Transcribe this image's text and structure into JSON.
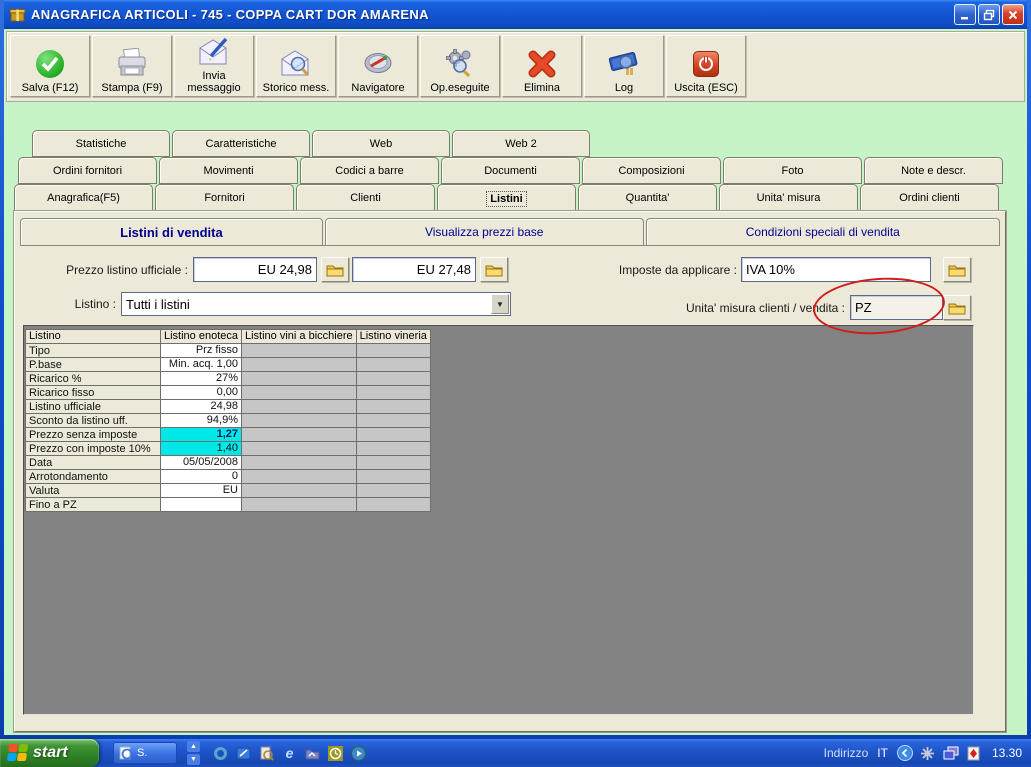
{
  "window": {
    "title": "ANAGRAFICA ARTICOLI - 745 - COPPA CART DOR AMARENA",
    "controls": [
      "minimize",
      "restore",
      "close"
    ]
  },
  "colors": {
    "desktop_green": "#c6f4c6",
    "panel_beige": "#ece9d8",
    "highlight_cyan": "#00e8e8",
    "annotation_red": "#cf1d1d",
    "content_gray": "#838383"
  },
  "toolbar": {
    "buttons": [
      {
        "label": "Salva (F12)",
        "icon": "save-check-icon"
      },
      {
        "label": "Stampa (F9)",
        "icon": "printer-icon"
      },
      {
        "label": "Invia\nmessaggio",
        "icon": "send-message-icon"
      },
      {
        "label": "Storico mess.",
        "icon": "message-history-icon"
      },
      {
        "label": "Navigatore",
        "icon": "compass-icon"
      },
      {
        "label": "Op.eseguite",
        "icon": "gears-search-icon"
      },
      {
        "label": "Elimina",
        "icon": "delete-x-icon"
      },
      {
        "label": "Log",
        "icon": "log-book-icon"
      },
      {
        "label": "Uscita (ESC)",
        "icon": "power-icon"
      }
    ]
  },
  "tabs": {
    "row1": [
      "Statistiche",
      "Caratteristiche",
      "Web",
      "Web 2"
    ],
    "row2": [
      "Ordini fornitori",
      "Movimenti",
      "Codici a barre",
      "Documenti",
      "Composizioni",
      "Foto",
      "Note e descr."
    ],
    "row3": [
      "Anagrafica(F5)",
      "Fornitori",
      "Clienti",
      "Listini",
      "Quantita'",
      "Unita' misura",
      "Ordini clienti"
    ],
    "active_tab": "Listini"
  },
  "subtabs": [
    "Listini di vendita",
    "Visualizza prezzi base",
    "Condizioni speciali di vendita"
  ],
  "active_subtab": "Listini di vendita",
  "form": {
    "prezzo_listino_label": "Prezzo listino ufficiale :",
    "prezzo_value1": "EU 24,98",
    "prezzo_value2": "EU 27,48",
    "listino_label": "Listino :",
    "listino_value": "Tutti i listini",
    "imposte_label": "Imposte da applicare :",
    "imposte_value": "IVA 10%",
    "unita_label": "Unita' misura clienti / vendita :",
    "unita_value": "PZ"
  },
  "chart_data": {
    "type": "table",
    "title": "Listini di vendita",
    "headers": [
      "Listino",
      "Listino enoteca",
      "Listino vini a bicchiere",
      "Listino vineria"
    ],
    "rows": [
      {
        "label": "Tipo",
        "value": "Prz fisso",
        "highlight": false
      },
      {
        "label": "P.base",
        "value": "Min. acq.\n1,00",
        "highlight": false
      },
      {
        "label": "Ricarico %",
        "value": "27%",
        "highlight": false
      },
      {
        "label": "Ricarico fisso",
        "value": "0,00",
        "highlight": false
      },
      {
        "label": "Listino ufficiale",
        "value": "24,98",
        "highlight": false
      },
      {
        "label": "Sconto da listino uff.",
        "value": "94,9%",
        "highlight": false
      },
      {
        "label": "Prezzo senza imposte",
        "value": "1,27",
        "highlight": true
      },
      {
        "label": "Prezzo con imposte 10%",
        "value": "1,40",
        "highlight": true
      },
      {
        "label": "Data",
        "value": "05/05/2008",
        "highlight": false
      },
      {
        "label": "Arrotondamento",
        "value": "0",
        "highlight": false
      },
      {
        "label": "Valuta",
        "value": "EU",
        "highlight": false
      },
      {
        "label": "Fino a PZ",
        "value": "",
        "highlight": false
      }
    ]
  },
  "taskbar": {
    "start_label": "start",
    "app_button_label": "S.",
    "address_label": "Indirizzo",
    "language_indicator": "IT",
    "clock": "13.30",
    "quicklaunch_icons": [
      "quicktime-icon",
      "messenger-icon",
      "search-doc-icon",
      "internet-explorer-icon",
      "photo-folder-icon",
      "timer-icon",
      "media-player-icon"
    ],
    "tray_icons": [
      "collapse-chevron-icon",
      "network-star-icon",
      "display-icon",
      "antivirus-icon"
    ]
  }
}
